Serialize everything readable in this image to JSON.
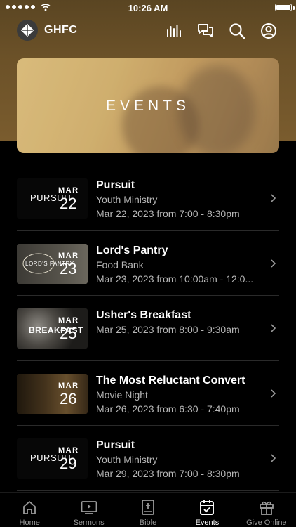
{
  "status_bar": {
    "time": "10:26 AM"
  },
  "header": {
    "title": "GHFC"
  },
  "banner": {
    "title": "EVENTS"
  },
  "events": [
    {
      "thumb_word": "PURSUIT",
      "month": "MAR",
      "day": "22",
      "title": "Pursuit",
      "subtitle": "Youth Ministry",
      "when": "Mar 22, 2023 from 7:00 - 8:30pm"
    },
    {
      "thumb_word": "LORD'S PANTRY",
      "month": "MAR",
      "day": "23",
      "title": "Lord's Pantry",
      "subtitle": "Food Bank",
      "when": "Mar 23, 2023 from 10:00am - 12:0..."
    },
    {
      "thumb_word": "BREAKFAST",
      "month": "MAR",
      "day": "25",
      "title": "Usher's Breakfast",
      "subtitle": "",
      "when": "Mar 25, 2023 from 8:00 - 9:30am"
    },
    {
      "thumb_word": "",
      "month": "MAR",
      "day": "26",
      "title": "The Most Reluctant Convert",
      "subtitle": "Movie Night",
      "when": "Mar 26, 2023 from 6:30 - 7:40pm"
    },
    {
      "thumb_word": "PURSUIT",
      "month": "MAR",
      "day": "29",
      "title": "Pursuit",
      "subtitle": "Youth Ministry",
      "when": "Mar 29, 2023 from 7:00 - 8:30pm"
    }
  ],
  "tabs": [
    {
      "label": "Home",
      "icon": "home-icon"
    },
    {
      "label": "Sermons",
      "icon": "video-icon"
    },
    {
      "label": "Bible",
      "icon": "bible-icon"
    },
    {
      "label": "Events",
      "icon": "calendar-icon",
      "active": true
    },
    {
      "label": "Give Online",
      "icon": "gift-icon"
    }
  ],
  "colors": {
    "background": "#000000",
    "header_gold": "#6b5128",
    "muted_text": "#b6b6b6",
    "inactive_tab": "#9a9a9a"
  }
}
